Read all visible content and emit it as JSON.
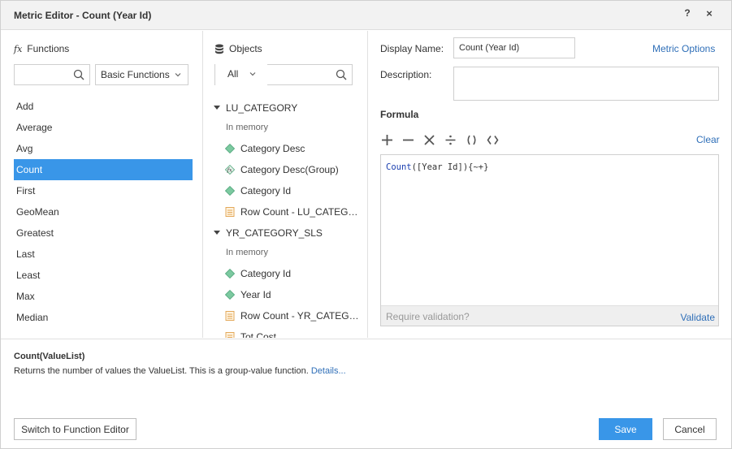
{
  "dialog": {
    "title": "Metric Editor - Count (Year Id)",
    "help_label": "?",
    "close_label": "×"
  },
  "functions": {
    "header": "Functions",
    "fx_glyph": "fx",
    "search_value": "",
    "category": "Basic Functions",
    "items": [
      "Add",
      "Average",
      "Avg",
      "Count",
      "First",
      "GeoMean",
      "Greatest",
      "Last",
      "Least",
      "Max",
      "Median"
    ],
    "selected": "Count"
  },
  "objects": {
    "header": "Objects",
    "filter": "All",
    "search_value": "",
    "groups": [
      {
        "name": "LU_CATEGORY",
        "sub": "In memory",
        "items": [
          {
            "label": "Category Desc",
            "icon": "attribute-icon"
          },
          {
            "label": "Category Desc(Group)",
            "icon": "derived-attribute-icon"
          },
          {
            "label": "Category Id",
            "icon": "attribute-icon"
          },
          {
            "label": "Row Count - LU_CATEGORY",
            "icon": "metric-icon"
          }
        ]
      },
      {
        "name": "YR_CATEGORY_SLS",
        "sub": "In memory",
        "items": [
          {
            "label": "Category Id",
            "icon": "attribute-icon"
          },
          {
            "label": "Year Id",
            "icon": "attribute-icon"
          },
          {
            "label": "Row Count - YR_CATEGORY_SLS",
            "icon": "metric-icon"
          },
          {
            "label": "Tot Cost",
            "icon": "metric-icon"
          }
        ]
      }
    ]
  },
  "editor": {
    "display_name_label": "Display Name:",
    "display_name_value": "Count (Year Id)",
    "metric_options_label": "Metric Options",
    "description_label": "Description:",
    "description_value": "",
    "formula_label": "Formula",
    "clear_label": "Clear",
    "formula_function": "Count",
    "formula_rest": "([Year Id]){~+}",
    "footer_hint": "Require validation?",
    "validate_label": "Validate"
  },
  "info": {
    "signature": "Count(ValueList)",
    "description": "Returns the number of values the ValueList. This is a group-value function.",
    "details_link": "Details..."
  },
  "buttons": {
    "switch": "Switch to Function Editor",
    "save": "Save",
    "cancel": "Cancel"
  },
  "colors": {
    "accent": "#3996e8",
    "link": "#2f6fb8",
    "attribute": "#7cc9a0",
    "metric": "#e0a04a"
  }
}
